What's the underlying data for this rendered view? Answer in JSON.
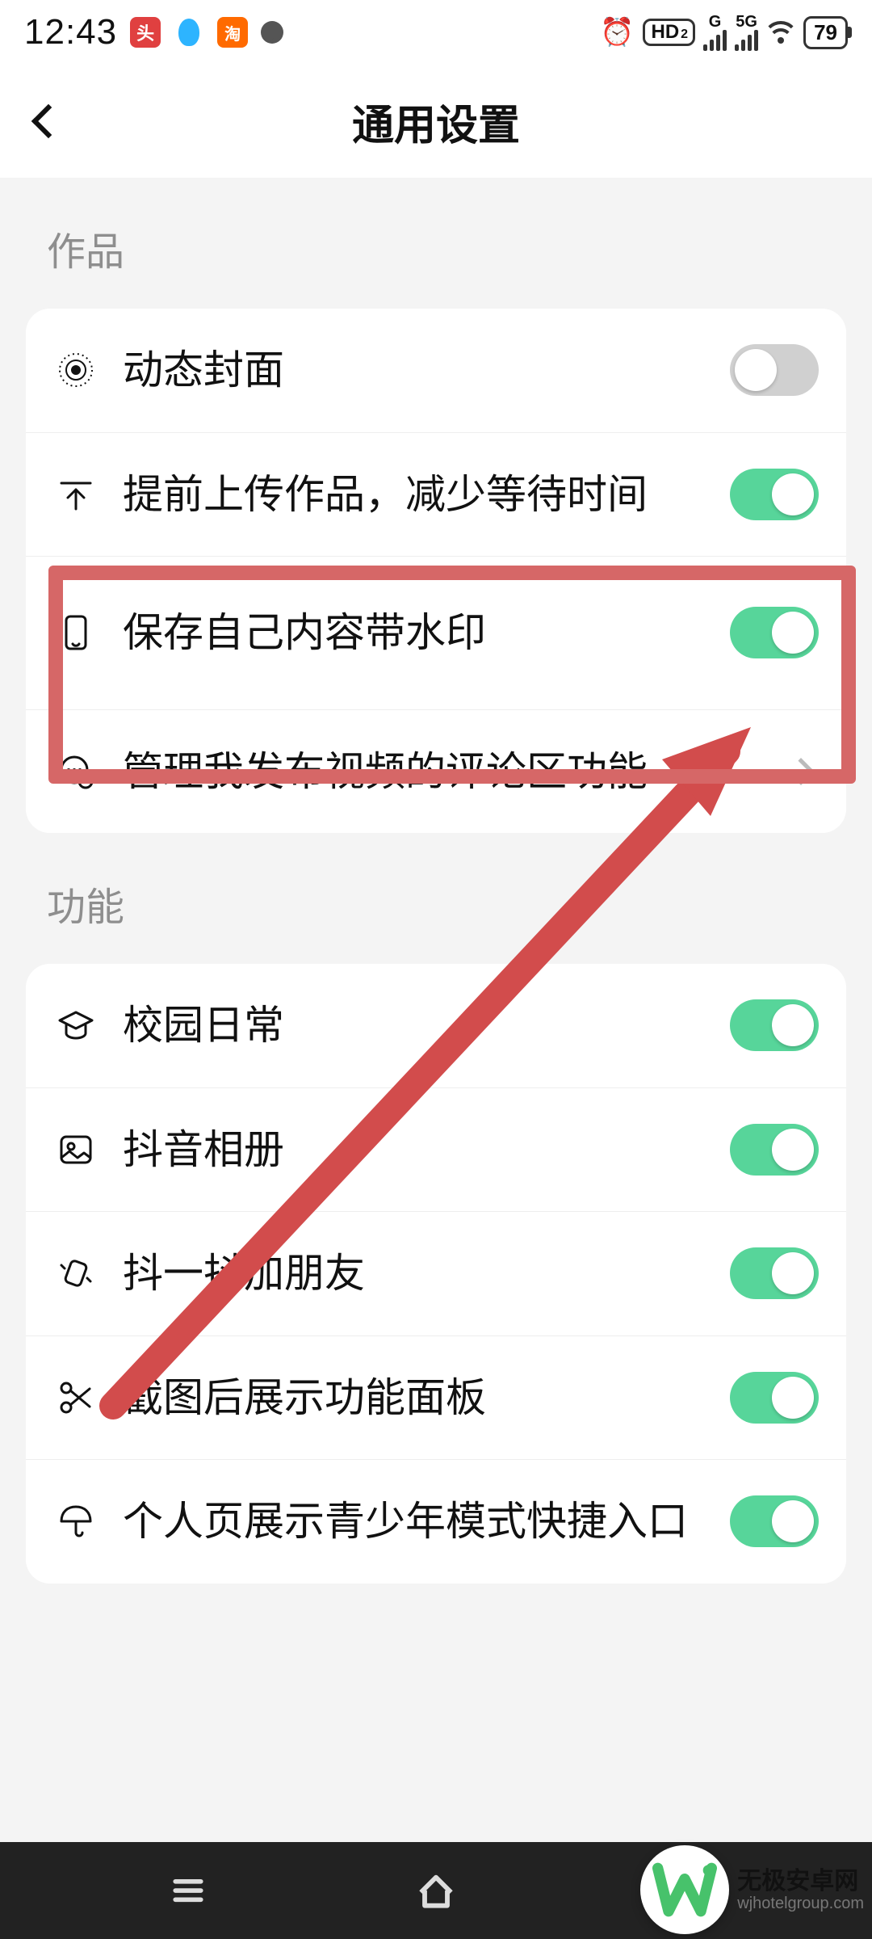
{
  "status": {
    "time": "12:43",
    "left_app_icons": [
      "头条",
      "qq",
      "淘"
    ],
    "alarm_icon": "alarm-icon",
    "hd_badge": "HD",
    "hd_sub": "2",
    "signal1_label": "G",
    "signal2_label": "5G",
    "battery": "79"
  },
  "header": {
    "title": "通用设置",
    "back_icon": "chevron-left"
  },
  "sections": {
    "works": {
      "title": "作品",
      "items": [
        {
          "icon": "target-icon",
          "label": "动态封面",
          "type": "toggle",
          "on": false
        },
        {
          "icon": "upload-icon",
          "label": "提前上传作品，减少等待时间",
          "type": "toggle",
          "on": true,
          "truncate": true
        },
        {
          "icon": "phone-icon",
          "label": "保存自己内容带水印",
          "type": "toggle",
          "on": true,
          "highlighted": true
        },
        {
          "icon": "comment-icon",
          "label": "管理我发布视频的评论区功能",
          "type": "nav"
        }
      ]
    },
    "features": {
      "title": "功能",
      "items": [
        {
          "icon": "graduation-icon",
          "label": "校园日常",
          "type": "toggle",
          "on": true
        },
        {
          "icon": "image-icon",
          "label": "抖音相册",
          "type": "toggle",
          "on": true
        },
        {
          "icon": "shake-icon",
          "label": "抖一抖加朋友",
          "type": "toggle",
          "on": true
        },
        {
          "icon": "scissors-icon",
          "label": "截图后展示功能面板",
          "type": "toggle",
          "on": true
        },
        {
          "icon": "umbrella-icon",
          "label": "个人页展示青少年模式快捷入口",
          "type": "toggle",
          "on": true
        }
      ]
    }
  },
  "nav": {
    "recent_icon": "menu-icon",
    "home_icon": "home-icon",
    "back_icon": "back-icon"
  },
  "watermark": {
    "logo_letter": "W",
    "cn": "无极安卓网",
    "en": "wjhotelgroup.com"
  },
  "colors": {
    "accent_green": "#57d59a",
    "highlight_red": "#d66767"
  }
}
